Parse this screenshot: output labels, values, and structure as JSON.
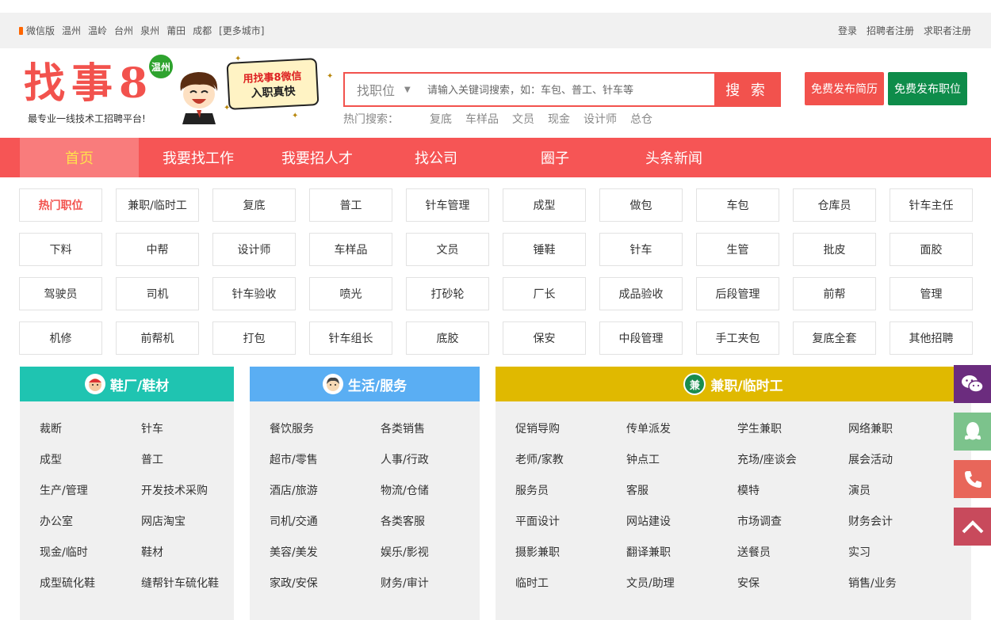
{
  "topbar": {
    "wechat": "微信版",
    "cities": [
      "温州",
      "温岭",
      "台州",
      "泉州",
      "莆田",
      "成都"
    ],
    "more_cities": "[更多城市]",
    "login": "登录",
    "employer_register": "招聘者注册",
    "seeker_register": "求职者注册"
  },
  "header": {
    "logo": "找事8",
    "city_badge": "温州",
    "slogan": "最专业一线技术工招聘平台!",
    "wechat_sign_line1": "用找事8微信",
    "wechat_sign_line2": "入职真快",
    "search_type": "找职位",
    "search_placeholder": "请输入关键词搜索，如：车包、普工、针车等",
    "search_button": "搜 索",
    "hot_label": "热门搜索：",
    "hot_terms": [
      "复底",
      "车样品",
      "文员",
      "现金",
      "设计师",
      "总仓"
    ],
    "publish_resume": "免费发布简历",
    "publish_job": "免费发布职位"
  },
  "nav": [
    "首页",
    "我要找工作",
    "我要招人才",
    "找公司",
    "圈子",
    "头条新闻"
  ],
  "tags": [
    [
      "热门职位",
      "兼职/临时工",
      "复底",
      "普工",
      "针车管理",
      "成型",
      "做包",
      "车包",
      "仓库员",
      "针车主任"
    ],
    [
      "下料",
      "中帮",
      "设计师",
      "车样品",
      "文员",
      "锤鞋",
      "针车",
      "生管",
      "批皮",
      "面胶"
    ],
    [
      "驾驶员",
      "司机",
      "针车验收",
      "喷光",
      "打砂轮",
      "厂长",
      "成品验收",
      "后段管理",
      "前帮",
      "管理"
    ],
    [
      "机修",
      "前帮机",
      "打包",
      "针车组长",
      "底胶",
      "保安",
      "中段管理",
      "手工夹包",
      "复底全套",
      "其他招聘"
    ]
  ],
  "categories": {
    "shoe": {
      "title": "鞋厂/鞋材",
      "color": "#1fc4b1",
      "items": [
        "裁断",
        "针车",
        "成型",
        "普工",
        "生产/管理",
        "开发技术采购",
        "办公室",
        "网店淘宝",
        "现金/临时",
        "鞋材",
        "成型硫化鞋",
        "缝帮针车硫化鞋"
      ]
    },
    "life": {
      "title": "生活/服务",
      "color": "#5aaef3",
      "items": [
        "餐饮服务",
        "各类销售",
        "超市/零售",
        "人事/行政",
        "酒店/旅游",
        "物流/仓储",
        "司机/交通",
        "各类客服",
        "美容/美发",
        "娱乐/影视",
        "家政/安保",
        "财务/审计"
      ]
    },
    "parttime": {
      "title": "兼职/临时工",
      "icon_char": "兼",
      "color": "#e0b900",
      "items": [
        "促销导购",
        "传单派发",
        "学生兼职",
        "网络兼职",
        "老师/家教",
        "钟点工",
        "充场/座谈会",
        "展会活动",
        "服务员",
        "客服",
        "模特",
        "演员",
        "平面设计",
        "网站建设",
        "市场调查",
        "财务会计",
        "摄影兼职",
        "翻译兼职",
        "送餐员",
        "实习",
        "临时工",
        "文员/助理",
        "安保",
        "销售/业务"
      ]
    }
  },
  "side_float": {
    "wechat_color": "#6b2c7e",
    "qq_color": "#7cc38c",
    "phone_color": "#e8665a",
    "top_color": "#c84a5c"
  }
}
